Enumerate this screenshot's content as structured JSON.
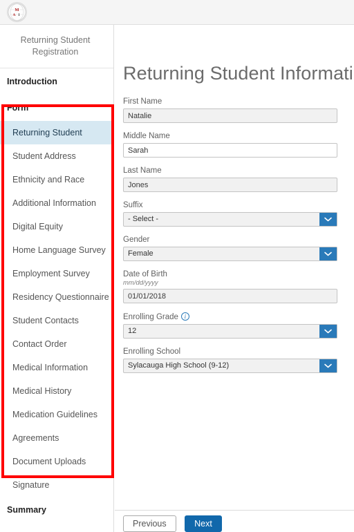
{
  "header": {
    "logo_name": "school-crest-logo"
  },
  "sidebar": {
    "title": "Returning Student Registration",
    "sections": [
      {
        "label": "Introduction"
      },
      {
        "label": "Form"
      }
    ],
    "items": [
      {
        "label": "Returning Student",
        "active": true
      },
      {
        "label": "Student Address",
        "active": false
      },
      {
        "label": "Ethnicity and Race",
        "active": false
      },
      {
        "label": "Additional Information",
        "active": false
      },
      {
        "label": "Digital Equity",
        "active": false
      },
      {
        "label": "Home Language Survey",
        "active": false
      },
      {
        "label": "Employment Survey",
        "active": false
      },
      {
        "label": "Residency Questionnaire",
        "active": false
      },
      {
        "label": "Student Contacts",
        "active": false
      },
      {
        "label": "Contact Order",
        "active": false
      },
      {
        "label": "Medical Information",
        "active": false
      },
      {
        "label": "Medical History",
        "active": false
      },
      {
        "label": "Medication Guidelines",
        "active": false
      },
      {
        "label": "Agreements",
        "active": false
      },
      {
        "label": "Document Uploads",
        "active": false
      },
      {
        "label": "Signature",
        "active": false
      }
    ],
    "summary_label": "Summary"
  },
  "main": {
    "page_title": "Returning Student Informatio",
    "fields": {
      "first_name": {
        "label": "First Name",
        "value": "Natalie",
        "readonly": true
      },
      "middle_name": {
        "label": "Middle Name",
        "value": "Sarah",
        "readonly": false
      },
      "last_name": {
        "label": "Last Name",
        "value": "Jones",
        "readonly": true
      },
      "suffix": {
        "label": "Suffix",
        "value": "- Select -"
      },
      "gender": {
        "label": "Gender",
        "value": "Female"
      },
      "date_of_birth": {
        "label": "Date of Birth",
        "hint": "mm/dd/yyyy",
        "value": "01/01/2018",
        "readonly": true
      },
      "enrolling_grade": {
        "label": "Enrolling Grade",
        "value": "12",
        "info_icon": "info-circle-icon"
      },
      "enrolling_school": {
        "label": "Enrolling School",
        "value": "Sylacauga High School (9-12)"
      }
    }
  },
  "footer": {
    "previous_label": "Previous",
    "next_label": "Next"
  },
  "annotation": {
    "color": "#ff0000"
  }
}
